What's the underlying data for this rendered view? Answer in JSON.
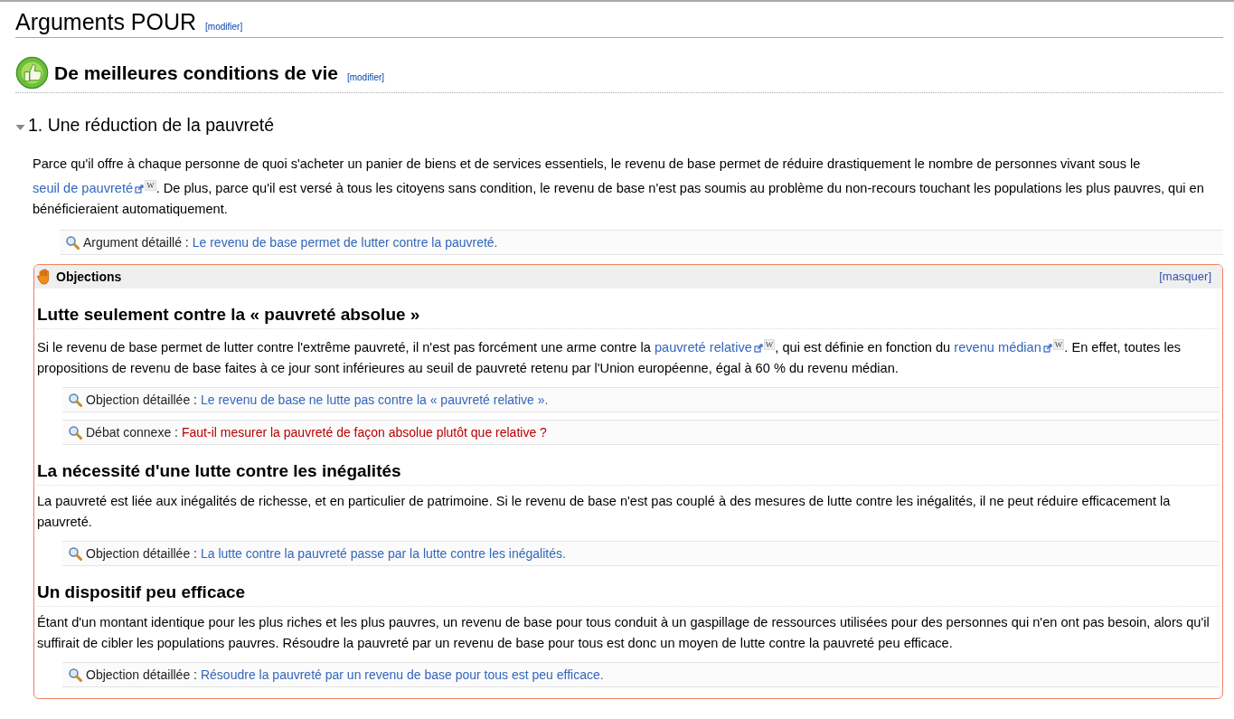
{
  "section": {
    "title": "Arguments POUR",
    "edit": "[modifier]"
  },
  "subsection": {
    "title": "De meilleures conditions de vie",
    "edit": "[modifier]"
  },
  "argument": {
    "title": "1. Une réduction de la pauvreté",
    "expanded": true,
    "paragraph": [
      {
        "kind": "text",
        "text": "Parce qu'il offre à chaque personne de quoi s'acheter un panier de biens et de services essentiels, le revenu de base permet de réduire drastiquement le nombre de personnes vivant sous le "
      },
      {
        "kind": "extlink",
        "text": "seuil de pauvreté",
        "mark": "W"
      },
      {
        "kind": "text",
        "text": ". De plus, parce qu'il est versé à tous les citoyens sans condition, le revenu de base n'est pas soumis au problème du non-recours touchant les populations les plus pauvres, qui en bénéficieraient automatiquement."
      }
    ],
    "details": [
      {
        "label": "Argument détaillé :",
        "link": "Le revenu de base permet de lutter contre la pauvreté.",
        "missing": false
      }
    ]
  },
  "objections": {
    "title": "Objections",
    "toggle": "[masquer]",
    "items": [
      {
        "title": "Lutte seulement contre la « pauvreté absolue »",
        "paragraph": [
          {
            "kind": "text",
            "text": "Si le revenu de base permet de lutter contre l'extrême pauvreté, il n'est pas forcément une arme contre la "
          },
          {
            "kind": "extlink",
            "text": "pauvreté relative",
            "mark": "W"
          },
          {
            "kind": "text",
            "text": ", qui est définie en fonction du "
          },
          {
            "kind": "extlink",
            "text": "revenu médian",
            "mark": "W"
          },
          {
            "kind": "text",
            "text": ". En effet, toutes les propositions de revenu de base faites à ce jour sont inférieures au seuil de pauvreté retenu par l'Union européenne, égal à 60 % du revenu médian."
          }
        ],
        "details": [
          {
            "label": "Objection détaillée :",
            "link": "Le revenu de base ne lutte pas contre la « pauvreté relative ».",
            "missing": false
          },
          {
            "label": "Débat connexe :",
            "link": "Faut-il mesurer la pauvreté de façon absolue plutôt que relative ?",
            "missing": true
          }
        ]
      },
      {
        "title": "La nécessité d'une lutte contre les inégalités",
        "paragraph": [
          {
            "kind": "text",
            "text": "La pauvreté est liée aux inégalités de richesse, et en particulier de patrimoine. Si le revenu de base n'est pas couplé à des mesures de lutte contre les inégalités, il ne peut réduire efficacement la pauvreté."
          }
        ],
        "details": [
          {
            "label": "Objection détaillée :",
            "link": "La lutte contre la pauvreté passe par la lutte contre les inégalités.",
            "missing": false
          }
        ]
      },
      {
        "title": "Un dispositif peu efficace",
        "paragraph": [
          {
            "kind": "text",
            "text": "Étant d'un montant identique pour les plus riches et les plus pauvres, un revenu de base pour tous conduit à un gaspillage de ressources utilisées pour des personnes qui n'en ont pas besoin, alors qu'il suffirait de cibler les populations pauvres. Résoudre la pauvreté par un revenu de base pour tous est donc un moyen de lutte contre la pauvreté peu efficace."
          }
        ],
        "details": [
          {
            "label": "Objection détaillée :",
            "link": "Résoudre la pauvreté par un revenu de base pour tous est peu efficace.",
            "missing": false
          }
        ]
      }
    ]
  }
}
